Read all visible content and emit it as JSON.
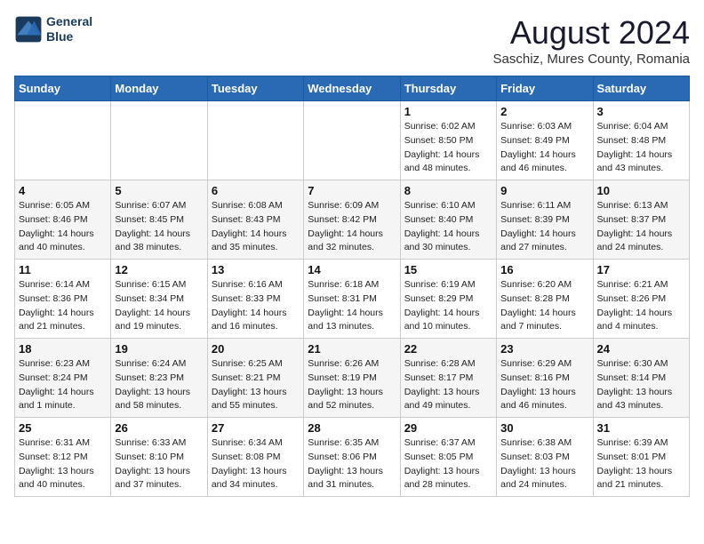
{
  "header": {
    "logo_line1": "General",
    "logo_line2": "Blue",
    "title": "August 2024",
    "subtitle": "Saschiz, Mures County, Romania"
  },
  "weekdays": [
    "Sunday",
    "Monday",
    "Tuesday",
    "Wednesday",
    "Thursday",
    "Friday",
    "Saturday"
  ],
  "weeks": [
    [
      {
        "day": "",
        "info": ""
      },
      {
        "day": "",
        "info": ""
      },
      {
        "day": "",
        "info": ""
      },
      {
        "day": "",
        "info": ""
      },
      {
        "day": "1",
        "info": "Sunrise: 6:02 AM\nSunset: 8:50 PM\nDaylight: 14 hours and 48 minutes."
      },
      {
        "day": "2",
        "info": "Sunrise: 6:03 AM\nSunset: 8:49 PM\nDaylight: 14 hours and 46 minutes."
      },
      {
        "day": "3",
        "info": "Sunrise: 6:04 AM\nSunset: 8:48 PM\nDaylight: 14 hours and 43 minutes."
      }
    ],
    [
      {
        "day": "4",
        "info": "Sunrise: 6:05 AM\nSunset: 8:46 PM\nDaylight: 14 hours and 40 minutes."
      },
      {
        "day": "5",
        "info": "Sunrise: 6:07 AM\nSunset: 8:45 PM\nDaylight: 14 hours and 38 minutes."
      },
      {
        "day": "6",
        "info": "Sunrise: 6:08 AM\nSunset: 8:43 PM\nDaylight: 14 hours and 35 minutes."
      },
      {
        "day": "7",
        "info": "Sunrise: 6:09 AM\nSunset: 8:42 PM\nDaylight: 14 hours and 32 minutes."
      },
      {
        "day": "8",
        "info": "Sunrise: 6:10 AM\nSunset: 8:40 PM\nDaylight: 14 hours and 30 minutes."
      },
      {
        "day": "9",
        "info": "Sunrise: 6:11 AM\nSunset: 8:39 PM\nDaylight: 14 hours and 27 minutes."
      },
      {
        "day": "10",
        "info": "Sunrise: 6:13 AM\nSunset: 8:37 PM\nDaylight: 14 hours and 24 minutes."
      }
    ],
    [
      {
        "day": "11",
        "info": "Sunrise: 6:14 AM\nSunset: 8:36 PM\nDaylight: 14 hours and 21 minutes."
      },
      {
        "day": "12",
        "info": "Sunrise: 6:15 AM\nSunset: 8:34 PM\nDaylight: 14 hours and 19 minutes."
      },
      {
        "day": "13",
        "info": "Sunrise: 6:16 AM\nSunset: 8:33 PM\nDaylight: 14 hours and 16 minutes."
      },
      {
        "day": "14",
        "info": "Sunrise: 6:18 AM\nSunset: 8:31 PM\nDaylight: 14 hours and 13 minutes."
      },
      {
        "day": "15",
        "info": "Sunrise: 6:19 AM\nSunset: 8:29 PM\nDaylight: 14 hours and 10 minutes."
      },
      {
        "day": "16",
        "info": "Sunrise: 6:20 AM\nSunset: 8:28 PM\nDaylight: 14 hours and 7 minutes."
      },
      {
        "day": "17",
        "info": "Sunrise: 6:21 AM\nSunset: 8:26 PM\nDaylight: 14 hours and 4 minutes."
      }
    ],
    [
      {
        "day": "18",
        "info": "Sunrise: 6:23 AM\nSunset: 8:24 PM\nDaylight: 14 hours and 1 minute."
      },
      {
        "day": "19",
        "info": "Sunrise: 6:24 AM\nSunset: 8:23 PM\nDaylight: 13 hours and 58 minutes."
      },
      {
        "day": "20",
        "info": "Sunrise: 6:25 AM\nSunset: 8:21 PM\nDaylight: 13 hours and 55 minutes."
      },
      {
        "day": "21",
        "info": "Sunrise: 6:26 AM\nSunset: 8:19 PM\nDaylight: 13 hours and 52 minutes."
      },
      {
        "day": "22",
        "info": "Sunrise: 6:28 AM\nSunset: 8:17 PM\nDaylight: 13 hours and 49 minutes."
      },
      {
        "day": "23",
        "info": "Sunrise: 6:29 AM\nSunset: 8:16 PM\nDaylight: 13 hours and 46 minutes."
      },
      {
        "day": "24",
        "info": "Sunrise: 6:30 AM\nSunset: 8:14 PM\nDaylight: 13 hours and 43 minutes."
      }
    ],
    [
      {
        "day": "25",
        "info": "Sunrise: 6:31 AM\nSunset: 8:12 PM\nDaylight: 13 hours and 40 minutes."
      },
      {
        "day": "26",
        "info": "Sunrise: 6:33 AM\nSunset: 8:10 PM\nDaylight: 13 hours and 37 minutes."
      },
      {
        "day": "27",
        "info": "Sunrise: 6:34 AM\nSunset: 8:08 PM\nDaylight: 13 hours and 34 minutes."
      },
      {
        "day": "28",
        "info": "Sunrise: 6:35 AM\nSunset: 8:06 PM\nDaylight: 13 hours and 31 minutes."
      },
      {
        "day": "29",
        "info": "Sunrise: 6:37 AM\nSunset: 8:05 PM\nDaylight: 13 hours and 28 minutes."
      },
      {
        "day": "30",
        "info": "Sunrise: 6:38 AM\nSunset: 8:03 PM\nDaylight: 13 hours and 24 minutes."
      },
      {
        "day": "31",
        "info": "Sunrise: 6:39 AM\nSunset: 8:01 PM\nDaylight: 13 hours and 21 minutes."
      }
    ]
  ]
}
